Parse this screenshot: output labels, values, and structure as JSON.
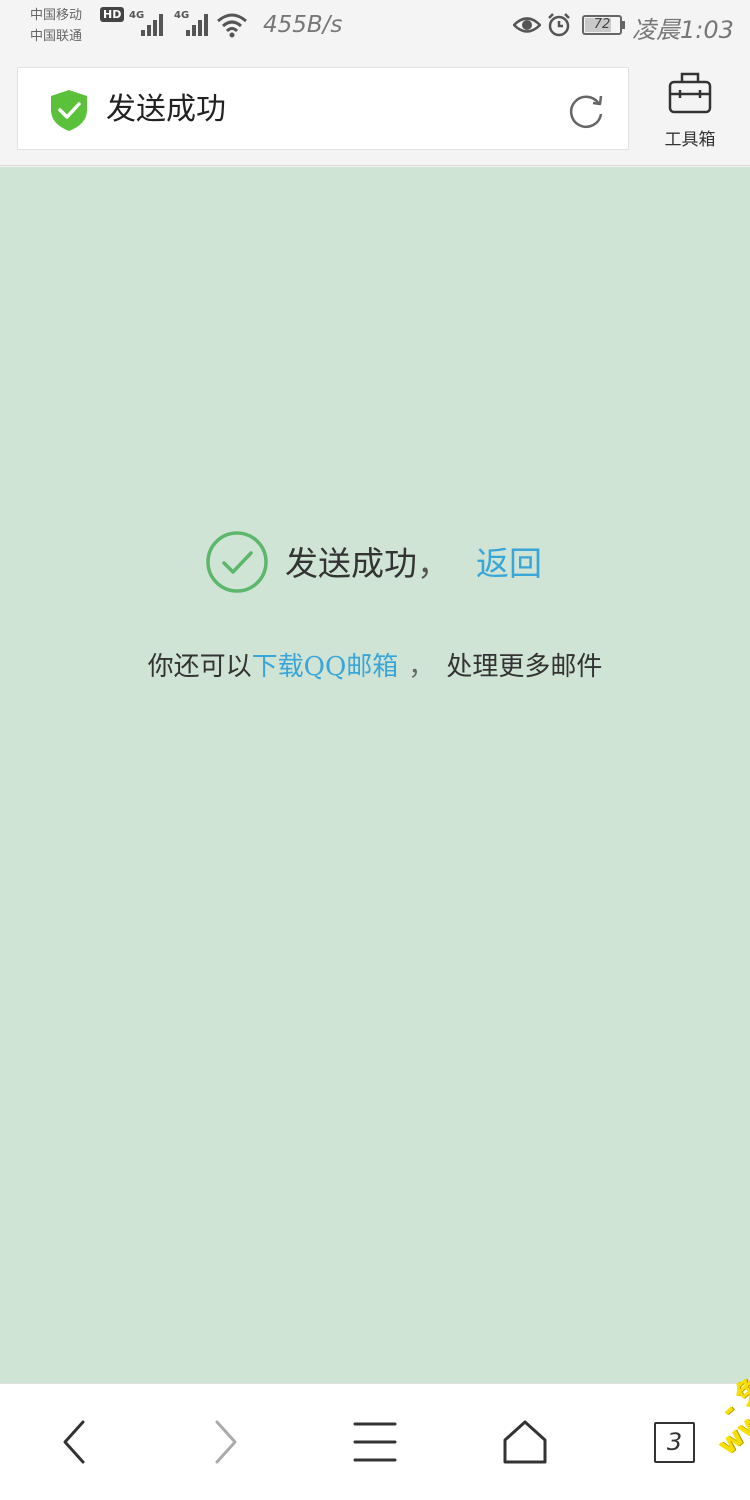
{
  "status_bar": {
    "carrier_1": "中国移动",
    "carrier_2": "中国联通",
    "hd_badge": "HD",
    "network_1": "4G",
    "network_2": "4G",
    "speed": "455B/s",
    "battery": "72",
    "time": "凌晨1:03"
  },
  "address_bar": {
    "page_title": "发送成功",
    "toolbox_label": "工具箱"
  },
  "main": {
    "success_text": "发送成功",
    "comma": "，",
    "back_link": "返回",
    "hint_prefix": "你还可以",
    "download_link": "下载QQ邮箱",
    "hint_sep": "，",
    "hint_suffix": "处理更多邮件"
  },
  "bottom_nav": {
    "tab_count": "3"
  },
  "watermark": {
    "line_1": "- 免费色色 -",
    "line_2": "www.Mfsese.com"
  },
  "colors": {
    "background": "#d0e4d5",
    "link": "#3aa6d8",
    "shield": "#5cc13a",
    "check": "#5cb66b"
  },
  "icons": [
    "shield-check-icon",
    "refresh-icon",
    "toolbox-icon",
    "check-circle-icon",
    "back-icon",
    "forward-icon",
    "menu-icon",
    "home-icon",
    "tabs-icon",
    "eye-icon",
    "alarm-icon",
    "wifi-icon",
    "signal-icon",
    "battery-icon"
  ]
}
